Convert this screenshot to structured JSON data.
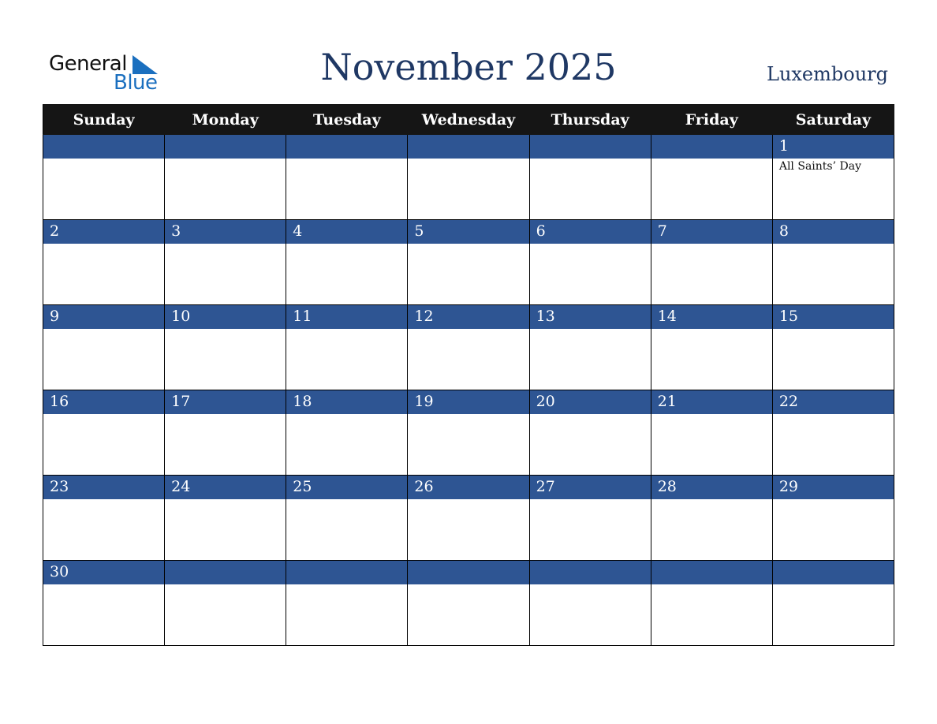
{
  "logo": {
    "line1": "General",
    "line2": "Blue"
  },
  "header": {
    "title": "November 2025",
    "country": "Luxembourg"
  },
  "weekdays": [
    "Sunday",
    "Monday",
    "Tuesday",
    "Wednesday",
    "Thursday",
    "Friday",
    "Saturday"
  ],
  "weeks": [
    [
      {
        "day": "",
        "event": ""
      },
      {
        "day": "",
        "event": ""
      },
      {
        "day": "",
        "event": ""
      },
      {
        "day": "",
        "event": ""
      },
      {
        "day": "",
        "event": ""
      },
      {
        "day": "",
        "event": ""
      },
      {
        "day": "1",
        "event": "All Saints’ Day"
      }
    ],
    [
      {
        "day": "2",
        "event": ""
      },
      {
        "day": "3",
        "event": ""
      },
      {
        "day": "4",
        "event": ""
      },
      {
        "day": "5",
        "event": ""
      },
      {
        "day": "6",
        "event": ""
      },
      {
        "day": "7",
        "event": ""
      },
      {
        "day": "8",
        "event": ""
      }
    ],
    [
      {
        "day": "9",
        "event": ""
      },
      {
        "day": "10",
        "event": ""
      },
      {
        "day": "11",
        "event": ""
      },
      {
        "day": "12",
        "event": ""
      },
      {
        "day": "13",
        "event": ""
      },
      {
        "day": "14",
        "event": ""
      },
      {
        "day": "15",
        "event": ""
      }
    ],
    [
      {
        "day": "16",
        "event": ""
      },
      {
        "day": "17",
        "event": ""
      },
      {
        "day": "18",
        "event": ""
      },
      {
        "day": "19",
        "event": ""
      },
      {
        "day": "20",
        "event": ""
      },
      {
        "day": "21",
        "event": ""
      },
      {
        "day": "22",
        "event": ""
      }
    ],
    [
      {
        "day": "23",
        "event": ""
      },
      {
        "day": "24",
        "event": ""
      },
      {
        "day": "25",
        "event": ""
      },
      {
        "day": "26",
        "event": ""
      },
      {
        "day": "27",
        "event": ""
      },
      {
        "day": "28",
        "event": ""
      },
      {
        "day": "29",
        "event": ""
      }
    ],
    [
      {
        "day": "30",
        "event": ""
      },
      {
        "day": "",
        "event": ""
      },
      {
        "day": "",
        "event": ""
      },
      {
        "day": "",
        "event": ""
      },
      {
        "day": "",
        "event": ""
      },
      {
        "day": "",
        "event": ""
      },
      {
        "day": "",
        "event": ""
      }
    ]
  ],
  "colors": {
    "header_bg": "#151515",
    "day_bar": "#2e5593",
    "title": "#1f3864",
    "logo_blue": "#1a6fbf"
  }
}
